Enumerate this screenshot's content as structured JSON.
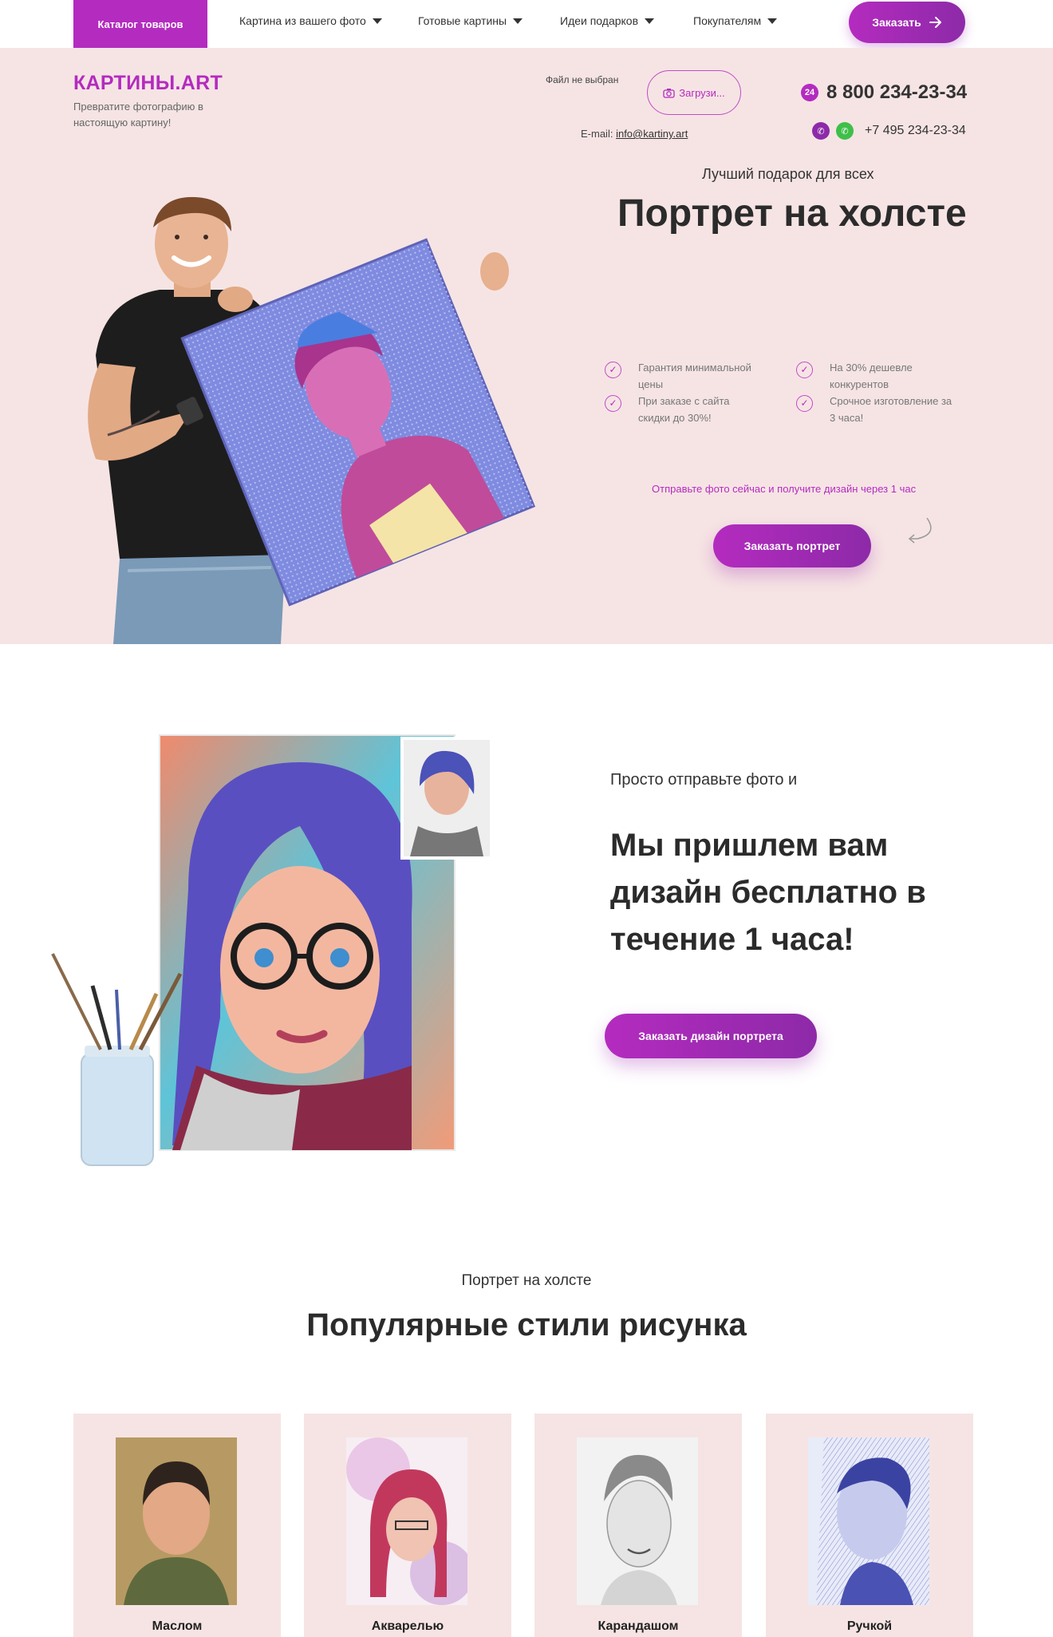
{
  "nav": {
    "catalog": "Каталог товаров",
    "items": [
      {
        "label": "Картина из вашего фото"
      },
      {
        "label": "Готовые картины"
      },
      {
        "label": "Идеи подарков"
      },
      {
        "label": "Покупателям"
      }
    ],
    "order": "Заказать"
  },
  "header": {
    "logo": "КАРТИНЫ.ART",
    "tagline": "Превратите фотографию в настоящую картину!",
    "file_status": "Файл не выбран",
    "upload": "Загрузи...",
    "email_label": "E-mail:",
    "email": "info@kartiny.art",
    "phone_main": "8 800 234-23-34",
    "phone_main_badge": "24",
    "phone_second": "+7 495 234-23-34"
  },
  "hero": {
    "subtitle": "Лучший подарок для всех",
    "title": "Портрет на холсте",
    "features": [
      "Гарантия минимальной цены",
      "На 30% дешевле конкурентов",
      "При заказе с сайта скидки до 30%!",
      "Срочное изготовление за 3 часа!"
    ],
    "hint": "Отправьте фото сейчас и получите дизайн через 1 час",
    "button": "Заказать портрет"
  },
  "design": {
    "subtitle": "Просто отправьте фото и",
    "title": "Мы пришлем вам дизайн бесплатно в течение 1 часа!",
    "button": "Заказать дизайн портрета"
  },
  "styles": {
    "subtitle": "Портрет на холсте",
    "title": "Популярные стили рисунка",
    "cards": [
      {
        "label": "Маслом"
      },
      {
        "label": "Акварелью"
      },
      {
        "label": "Карандашом"
      },
      {
        "label": "Ручкой"
      }
    ]
  },
  "colors": {
    "accent": "#b42bbf",
    "hero_bg": "#f6e4e4",
    "whatsapp": "#3fbf4a"
  },
  "icons": [
    "caret-down-icon",
    "arrow-right-icon",
    "camera-icon",
    "phone-24-icon",
    "viber-icon",
    "whatsapp-icon",
    "check-circle-icon",
    "curved-arrow-icon"
  ]
}
